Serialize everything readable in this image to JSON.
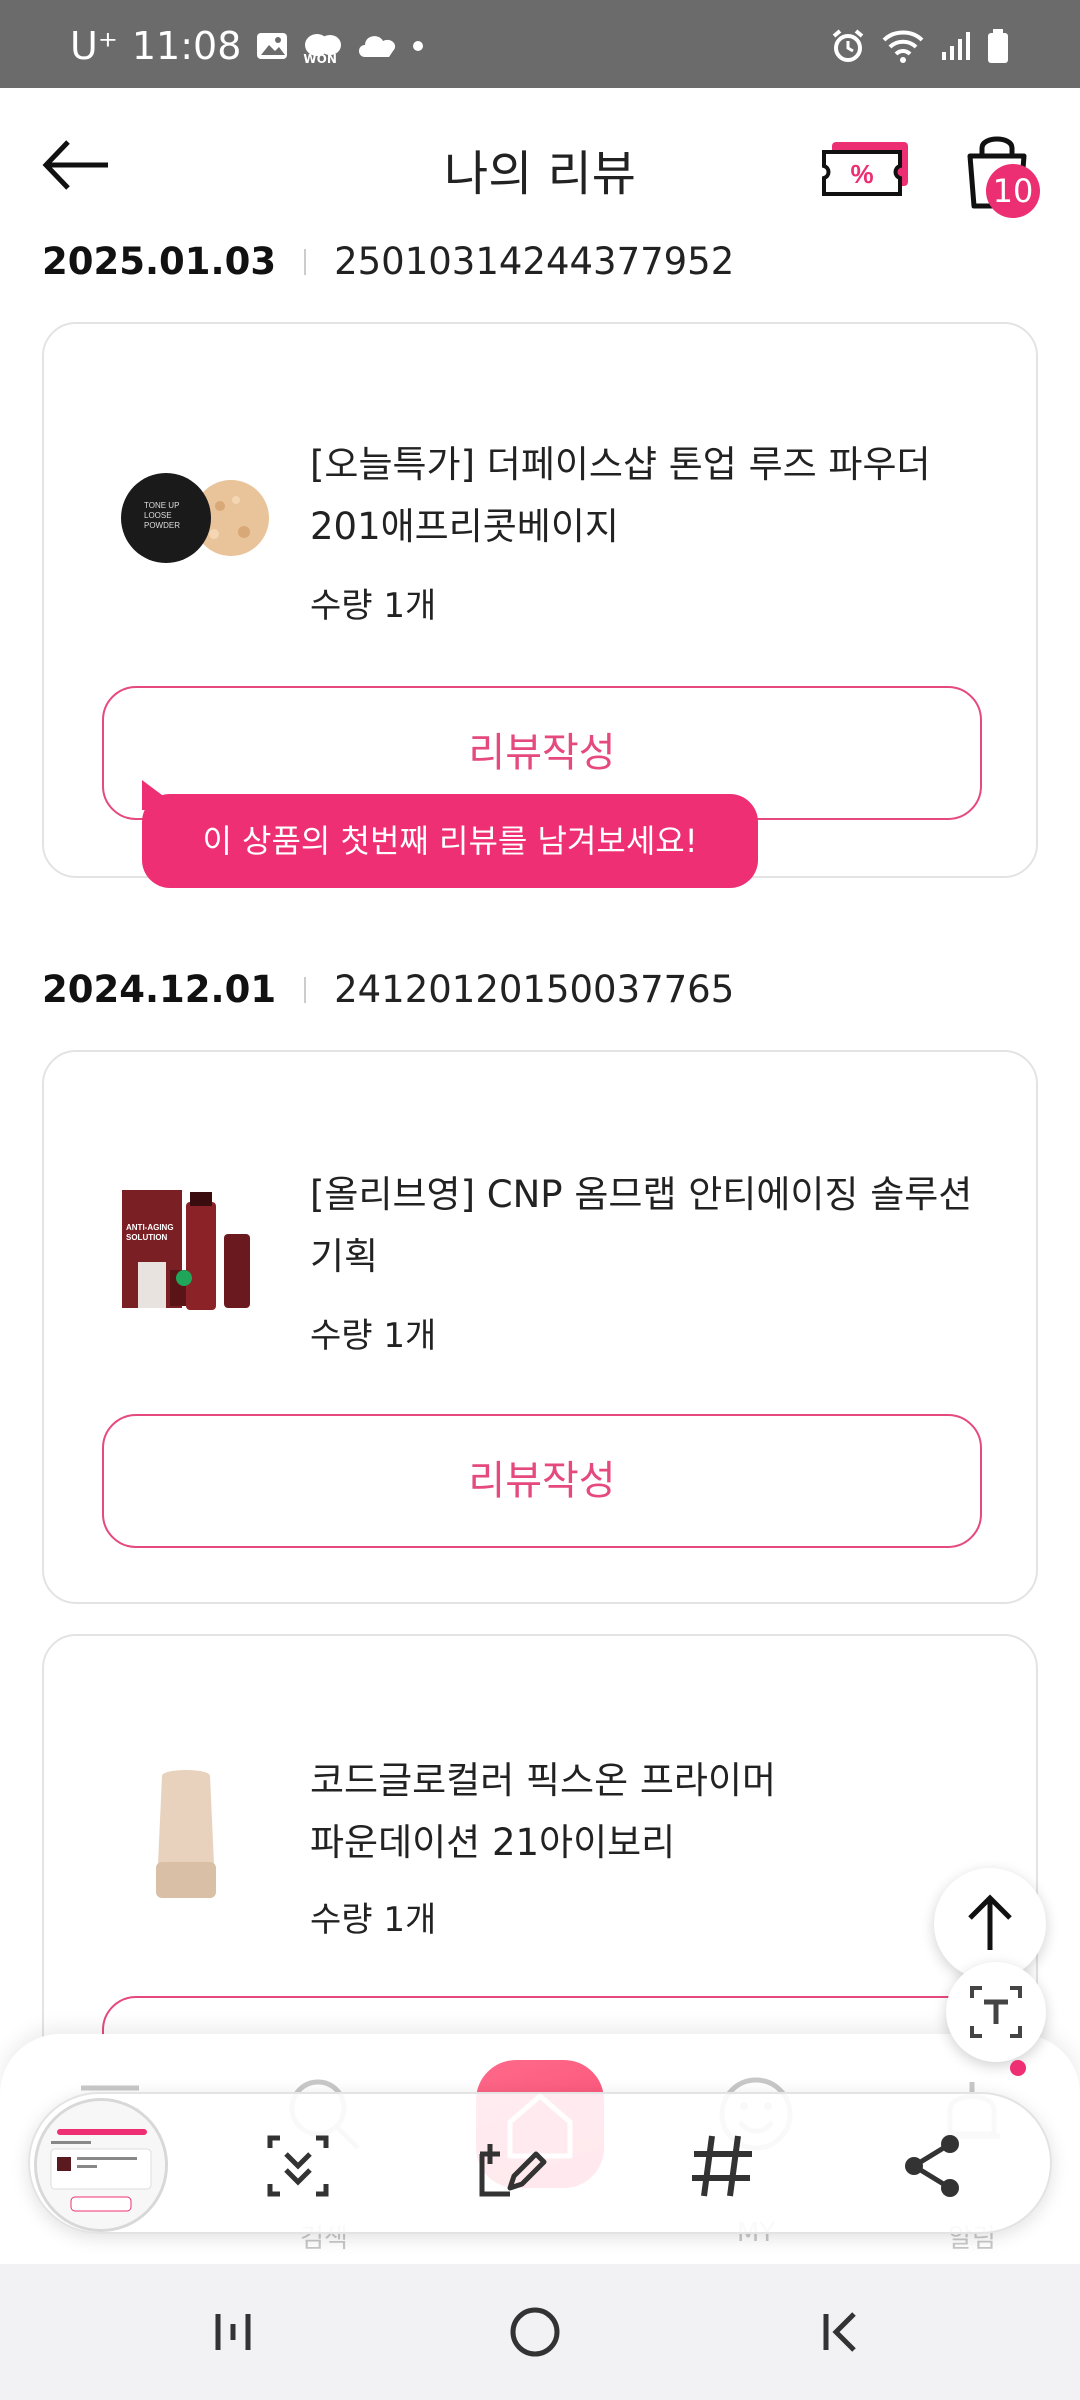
{
  "status_bar": {
    "carrier": "U⁺",
    "time": "11:08",
    "won_label": "WON"
  },
  "header": {
    "title": "나의 리뷰",
    "coupon_icon_text": "%",
    "cart_badge": "10"
  },
  "orders": [
    {
      "date": "2025.01.03",
      "order_no": "25010314244377952",
      "product_line1": "[오늘특가] 더페이스샵 톤업 루즈 파우더",
      "product_line2": "201애프리콧베이지",
      "quantity": "수량 1개",
      "button": "리뷰작성",
      "tooltip": "이 상품의 첫번째 리뷰를 남겨보세요!",
      "image_caption": [
        "TONE UP",
        "LOOSE",
        "POWDER"
      ]
    },
    {
      "date": "2024.12.01",
      "order_no": "24120120150037765",
      "product_line1": "[올리브영] CNP 옴므랩 안티에이징 솔루션",
      "product_line2": "기획",
      "quantity": "수량 1개",
      "button": "리뷰작성",
      "image_caption": [
        "ANTI-AGING",
        "SOLUTION"
      ]
    },
    {
      "product_line1": "코드글로컬러 픽스온 프라이머",
      "product_line2": "파운데이션 21아이보리",
      "quantity": "수량 1개"
    }
  ],
  "tabbar": {
    "search_label": "검색",
    "my_label": "MY",
    "alarm_label": "알림"
  },
  "icons": {
    "back": "arrow-left-icon",
    "coupon": "coupon-icon",
    "cart": "shopping-bag-icon",
    "scroll_top": "arrow-up-icon",
    "extract_text": "text-extract-icon"
  },
  "colors": {
    "accent": "#ec2e72",
    "button_border": "#e5497d"
  }
}
